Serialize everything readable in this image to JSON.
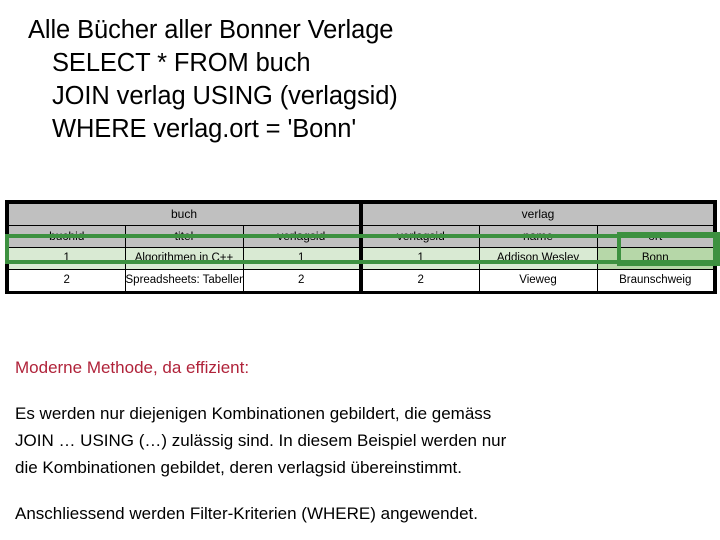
{
  "slide": {
    "heading_lines": [
      "Alle Bücher aller Bonner Verlage",
      "SELECT * FROM buch",
      "JOIN verlag USING (verlagsid)",
      "WHERE verlag.ort = 'Bonn'"
    ],
    "note_heading": "Moderne Methode, da effizient:",
    "paragraph_1_lines": [
      "Es werden nur diejenigen Kombinationen gebildert, die gemäss",
      "JOIN … USING (…) zulässig sind. In diesem Beispiel werden nur",
      "die Kombinationen gebildet, deren verlagsid übereinstimmt."
    ],
    "paragraph_2_lines": [
      "Anschliessend werden Filter-Kriterien (WHERE) angewendet."
    ]
  },
  "table": {
    "group_headers": [
      {
        "label": "buch",
        "colspan": 3
      },
      {
        "label": "verlag",
        "colspan": 3
      }
    ],
    "column_headers": [
      "buchid",
      "titel",
      "verlagsid",
      "verlagsid",
      "name",
      "ort"
    ],
    "rows": [
      {
        "highlighted": true,
        "cells": [
          "1",
          "Algorithmen in C++",
          "1",
          "1",
          "Addison Wesley",
          "Bonn"
        ]
      },
      {
        "highlighted": false,
        "cells": [
          "2",
          "Spreadsheets: Tabellenkalkulation",
          "2",
          "2",
          "Vieweg",
          "Braunschweig"
        ]
      }
    ],
    "highlight_boxes": [
      "matching-join-row",
      "filter-match-ort-bonn"
    ]
  },
  "colors": {
    "highlight_green": "#3d9140",
    "row_fill_green": "#d9ead3",
    "cell_fill_green": "#b6d7a8",
    "header_gray": "#c0c0c0",
    "note_red": "#b0233a",
    "text_black": "#000000"
  }
}
